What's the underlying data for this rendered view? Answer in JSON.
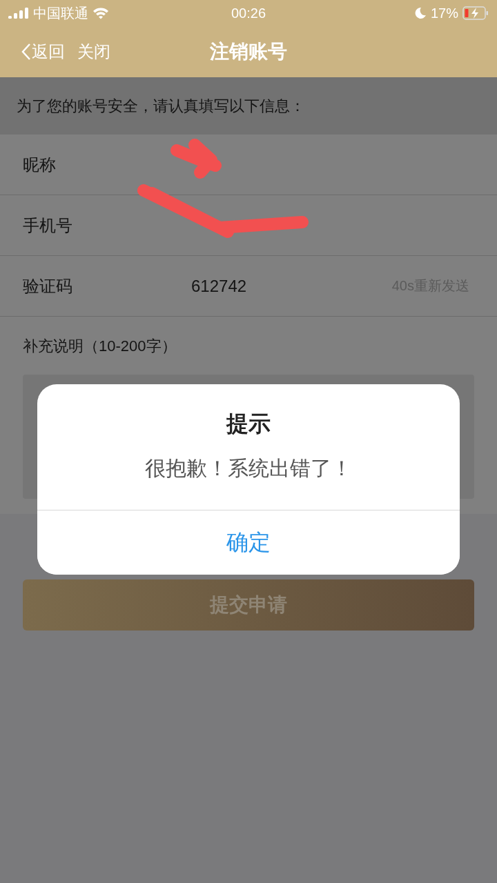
{
  "status_bar": {
    "carrier": "中国联通",
    "time": "00:26",
    "battery_percent": "17%"
  },
  "nav": {
    "back": "返回",
    "close": "关闭",
    "title": "注销账号"
  },
  "notice": "为了您的账号安全，请认真填写以下信息：",
  "fields": [
    {
      "label": "昵称"
    },
    {
      "label": "手机号"
    },
    {
      "label": "验证码",
      "value": "612742",
      "action": "40s重新发送"
    }
  ],
  "remarks": {
    "label": "补充说明（10-200字）"
  },
  "submit_button": {
    "label": "提交申请",
    "disabled": true
  },
  "dialog": {
    "title": "提示",
    "message": "很抱歉！系统出错了！",
    "confirm": "确定"
  }
}
